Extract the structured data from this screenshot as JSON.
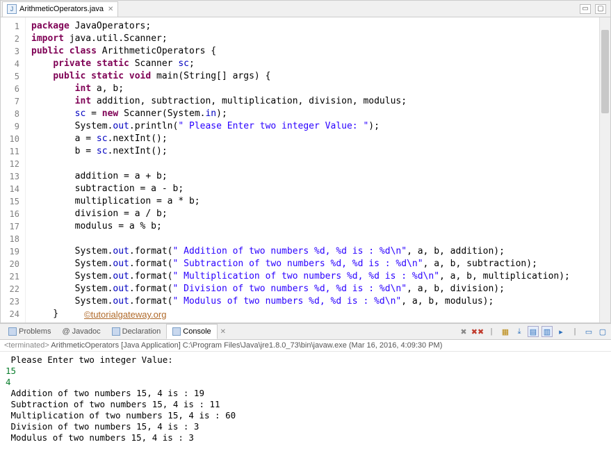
{
  "tab": {
    "filename": "ArithmeticOperators.java"
  },
  "gutter": [
    "1",
    "2",
    "3",
    "4",
    "5",
    "6",
    "7",
    "8",
    "9",
    "10",
    "11",
    "12",
    "13",
    "14",
    "15",
    "16",
    "17",
    "18",
    "19",
    "20",
    "21",
    "22",
    "23",
    "24"
  ],
  "code_tokens": [
    [
      [
        "kw",
        "package"
      ],
      [
        "typ",
        " JavaOperators;"
      ]
    ],
    [
      [
        "kw",
        "import"
      ],
      [
        "typ",
        " java.util.Scanner;"
      ]
    ],
    [
      [
        "kw",
        "public class"
      ],
      [
        "typ",
        " ArithmeticOperators {"
      ]
    ],
    [
      [
        "typ",
        "    "
      ],
      [
        "kw",
        "private static"
      ],
      [
        "typ",
        " Scanner "
      ],
      [
        "fld",
        "sc"
      ],
      [
        "typ",
        ";"
      ]
    ],
    [
      [
        "typ",
        "    "
      ],
      [
        "kw",
        "public static void"
      ],
      [
        "typ",
        " main(String[] args) {"
      ]
    ],
    [
      [
        "typ",
        "        "
      ],
      [
        "kw",
        "int"
      ],
      [
        "typ",
        " a, b;"
      ]
    ],
    [
      [
        "typ",
        "        "
      ],
      [
        "kw",
        "int"
      ],
      [
        "typ",
        " addition, subtraction, multiplication, division, modulus;"
      ]
    ],
    [
      [
        "typ",
        "        "
      ],
      [
        "fld",
        "sc"
      ],
      [
        "typ",
        " = "
      ],
      [
        "kw",
        "new"
      ],
      [
        "typ",
        " Scanner(System."
      ],
      [
        "fld",
        "in"
      ],
      [
        "typ",
        ");"
      ]
    ],
    [
      [
        "typ",
        "        System."
      ],
      [
        "fld",
        "out"
      ],
      [
        "typ",
        ".println("
      ],
      [
        "str",
        "\" Please Enter two integer Value: \""
      ],
      [
        "typ",
        ");"
      ]
    ],
    [
      [
        "typ",
        "        a = "
      ],
      [
        "fld",
        "sc"
      ],
      [
        "typ",
        ".nextInt();"
      ]
    ],
    [
      [
        "typ",
        "        b = "
      ],
      [
        "fld",
        "sc"
      ],
      [
        "typ",
        ".nextInt();"
      ]
    ],
    [
      [
        "typ",
        " "
      ]
    ],
    [
      [
        "typ",
        "        addition = a + b;"
      ]
    ],
    [
      [
        "typ",
        "        subtraction = a - b;"
      ]
    ],
    [
      [
        "typ",
        "        multiplication = a * b;"
      ]
    ],
    [
      [
        "typ",
        "        division = a / b;"
      ]
    ],
    [
      [
        "typ",
        "        modulus = a % b;"
      ]
    ],
    [
      [
        "typ",
        " "
      ]
    ],
    [
      [
        "typ",
        "        System."
      ],
      [
        "fld",
        "out"
      ],
      [
        "typ",
        ".format("
      ],
      [
        "str",
        "\" Addition of two numbers %d, %d is : %d\\n\""
      ],
      [
        "typ",
        ", a, b, addition);"
      ]
    ],
    [
      [
        "typ",
        "        System."
      ],
      [
        "fld",
        "out"
      ],
      [
        "typ",
        ".format("
      ],
      [
        "str",
        "\" Subtraction of two numbers %d, %d is : %d\\n\""
      ],
      [
        "typ",
        ", a, b, subtraction);"
      ]
    ],
    [
      [
        "typ",
        "        System."
      ],
      [
        "fld",
        "out"
      ],
      [
        "typ",
        ".format("
      ],
      [
        "str",
        "\" Multiplication of two numbers %d, %d is : %d\\n\""
      ],
      [
        "typ",
        ", a, b, multiplication);"
      ]
    ],
    [
      [
        "typ",
        "        System."
      ],
      [
        "fld",
        "out"
      ],
      [
        "typ",
        ".format("
      ],
      [
        "str",
        "\" Division of two numbers %d, %d is : %d\\n\""
      ],
      [
        "typ",
        ", a, b, division);"
      ]
    ],
    [
      [
        "typ",
        "        System."
      ],
      [
        "fld",
        "out"
      ],
      [
        "typ",
        ".format("
      ],
      [
        "str",
        "\" Modulus of two numbers %d, %d is : %d\\n\""
      ],
      [
        "typ",
        ", a, b, modulus);"
      ]
    ],
    [
      [
        "typ",
        "    }"
      ]
    ]
  ],
  "watermark": "©tutorialgateway.org",
  "views": {
    "problems": "Problems",
    "javadoc": "Javadoc",
    "declaration": "Declaration",
    "console": "Console"
  },
  "console": {
    "status": "<terminated>",
    "process": "ArithmeticOperators [Java Application] C:\\Program Files\\Java\\jre1.8.0_73\\bin\\javaw.exe (Mar 16, 2016, 4:09:30 PM)",
    "lines": [
      {
        "cls": "",
        "text": " Please Enter two integer Value: "
      },
      {
        "cls": "input-val",
        "text": "15"
      },
      {
        "cls": "input-val",
        "text": "4"
      },
      {
        "cls": "",
        "text": " Addition of two numbers 15, 4 is : 19"
      },
      {
        "cls": "",
        "text": " Subtraction of two numbers 15, 4 is : 11"
      },
      {
        "cls": "",
        "text": " Multiplication of two numbers 15, 4 is : 60"
      },
      {
        "cls": "",
        "text": " Division of two numbers 15, 4 is : 3"
      },
      {
        "cls": "",
        "text": " Modulus of two numbers 15, 4 is : 3"
      }
    ]
  }
}
